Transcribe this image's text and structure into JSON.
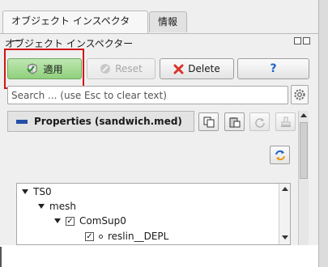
{
  "tabs": [
    {
      "label": "オブジェクト インスペクター",
      "active": true
    },
    {
      "label": "情報",
      "active": false
    }
  ],
  "panel_title": "オブジェクト インスペクター",
  "buttons": {
    "apply": "適用",
    "reset": "Reset",
    "delete": "Delete",
    "help_icon": "?"
  },
  "search": {
    "placeholder": "Search ... (use Esc to clear text)",
    "value": ""
  },
  "properties": {
    "header": "Properties (sandwich.med)"
  },
  "tree": [
    {
      "label": "TS0",
      "level": 0,
      "expanded": true,
      "checkbox": false
    },
    {
      "label": "mesh",
      "level": 1,
      "expanded": true,
      "checkbox": false
    },
    {
      "label": "ComSup0",
      "level": 2,
      "expanded": true,
      "checkbox": true,
      "checked": true
    },
    {
      "label": "reslin__DEPL",
      "level": 3,
      "expanded": false,
      "checkbox": true,
      "checked": true
    }
  ],
  "colors": {
    "apply_bg": "#a8dc96",
    "highlight": "#d11515",
    "delete_x": "#d9342b",
    "help": "#1e64c8"
  }
}
